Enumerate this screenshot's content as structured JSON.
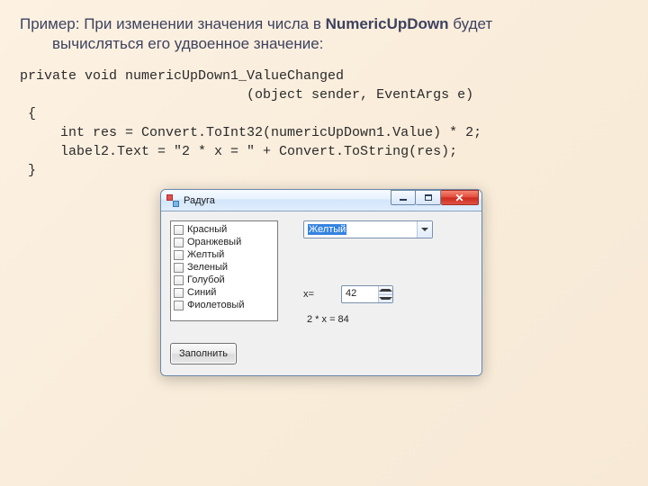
{
  "heading": {
    "part1": "Пример: При изменении значения числа в ",
    "bold": "NumericUpDown",
    "part2": " будет",
    "line2": "вычисляться его удвоенное значение:"
  },
  "code": "private void numericUpDown1_ValueChanged\n                            (object sender, EventArgs e)\n {\n     int res = Convert.ToInt32(numericUpDown1.Value) * 2;\n     label2.Text = \"2 * x = \" + Convert.ToString(res);\n }",
  "window": {
    "title": "Радуга",
    "list": [
      "Красный",
      "Оранжевый",
      "Желтый",
      "Зеленый",
      "Голубой",
      "Синий",
      "Фиолетовый"
    ],
    "combo_value": "Желтый",
    "x_label": "x=",
    "numeric_value": "42",
    "result_label": "2 * x = 84",
    "fill_button": "Заполнить"
  }
}
